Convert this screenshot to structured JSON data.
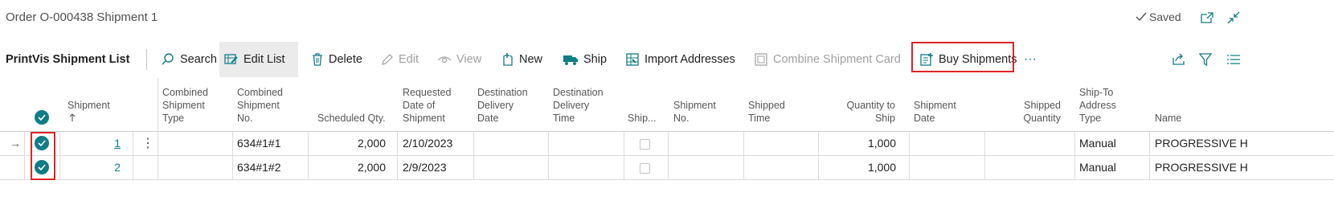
{
  "page": {
    "title": "Order O-000438 Shipment 1",
    "saved_label": "Saved"
  },
  "actionbar": {
    "list_title": "PrintVis Shipment List",
    "actions": {
      "search": "Search",
      "edit_list": "Edit List",
      "delete": "Delete",
      "edit": "Edit",
      "view": "View",
      "new": "New",
      "ship": "Ship",
      "import_addresses": "Import Addresses",
      "combine_shipment_card": "Combine Shipment Card",
      "buy_shipments": "Buy Shipments",
      "more": "···"
    }
  },
  "grid": {
    "columns": {
      "shipment": "Shipment",
      "combined_type": "Combined\nShipment\nType",
      "combined_no": "Combined\nShipment\nNo.",
      "scheduled_qty": "Scheduled Qty.",
      "requested_date": "Requested\nDate of\nShipment",
      "dest_delivery_date": "Destination\nDelivery\nDate",
      "dest_delivery_time": "Destination\nDelivery\nTime",
      "ship": "Ship...",
      "shipment_no": "Shipment\nNo.",
      "shipped_time": "Shipped\nTime",
      "qty_to_ship": "Quantity to\nShip",
      "shipment_date": "Shipment\nDate",
      "shipped_qty": "Shipped\nQuantity",
      "ship_to_type": "Ship-To\nAddress\nType",
      "name": "Name"
    },
    "rows": [
      {
        "shipment": "1",
        "combined_no": "634#1#1",
        "scheduled_qty": "2,000",
        "requested_date": "2/10/2023",
        "qty_to_ship": "1,000",
        "ship_to_type": "Manual",
        "name": "PROGRESSIVE HO"
      },
      {
        "shipment": "2",
        "combined_no": "634#1#2",
        "scheduled_qty": "2,000",
        "requested_date": "2/9/2023",
        "qty_to_ship": "1,000",
        "ship_to_type": "Manual",
        "name": "PROGRESSIVE HO"
      }
    ]
  },
  "colors": {
    "accent": "#0f7d86",
    "highlight": "#d9262a",
    "pressed_bg": "#ebebeb"
  }
}
